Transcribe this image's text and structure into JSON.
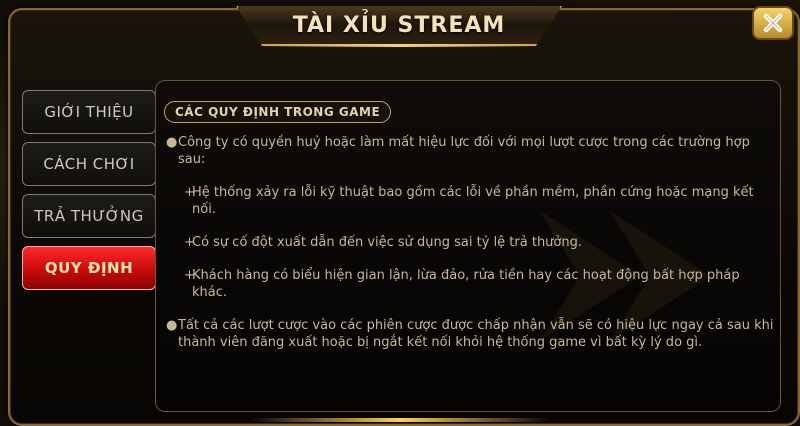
{
  "dialog": {
    "title": "TÀI XỈU STREAM",
    "close_icon": "close-x-icon"
  },
  "nav": {
    "items": [
      {
        "label": "GIỚI THIỆU",
        "active": false
      },
      {
        "label": "CÁCH CHƠI",
        "active": false
      },
      {
        "label": "TRẢ THƯỞNG",
        "active": false
      },
      {
        "label": "QUY ĐỊNH",
        "active": true
      }
    ]
  },
  "content": {
    "section_title": "CÁC QUY ĐỊNH TRONG GAME",
    "paragraph1": "Công ty có quyền huỷ hoặc làm mất hiệu lực đối với mọi lượt cược trong các trường hợp sau:",
    "items": [
      "Hệ thống xảy ra lỗi kỹ thuật bao gồm các lỗi về phần mềm, phần cứng hoặc mạng kết nối.",
      "Có sự cố đột xuất dẫn đến việc sử dụng sai tỷ lệ trả thưởng.",
      "Khách hàng có biểu hiện gian lận, lừa đảo, rửa tiền hay các hoạt động bất hợp pháp khác."
    ],
    "paragraph2": "Tất cả các lượt cược vào các phiên cược được chấp nhận vẫn sẽ có hiệu lực ngay cả sau khi thành viên đăng xuất hoặc bị ngắt kết nối khỏi hệ thống game vì bất kỳ lý do gì."
  },
  "colors": {
    "gold": "#c9a24a",
    "active_red": "#c80b0b",
    "text": "#c7b896"
  }
}
